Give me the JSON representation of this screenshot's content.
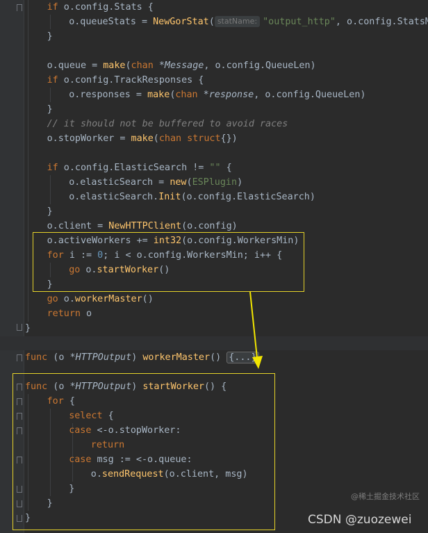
{
  "editor": {
    "lines": [
      {
        "id": "l1",
        "segments": [
          {
            "t": "if",
            "c": "kw"
          },
          {
            "t": " o.config.Stats {",
            "c": "pl"
          }
        ]
      },
      {
        "id": "l2",
        "segments": [
          {
            "t": "o.queueStats = ",
            "c": "pl"
          },
          {
            "t": "NewGorStat",
            "c": "fn"
          },
          {
            "t": "(",
            "c": "pl"
          },
          {
            "t": "statName:",
            "c": "hint"
          },
          {
            "t": "\"output_http\"",
            "c": "str"
          },
          {
            "t": ", o.config.StatsM",
            "c": "pl"
          }
        ]
      },
      {
        "id": "l3",
        "segments": [
          {
            "t": "}",
            "c": "pl"
          }
        ]
      },
      {
        "id": "l5",
        "segments": [
          {
            "t": "o.queue = ",
            "c": "pl"
          },
          {
            "t": "make",
            "c": "fn"
          },
          {
            "t": "(",
            "c": "pl"
          },
          {
            "t": "chan",
            "c": "kw"
          },
          {
            "t": " *",
            "c": "pl"
          },
          {
            "t": "Message",
            "c": "typ"
          },
          {
            "t": ", o.config.QueueLen)",
            "c": "pl"
          }
        ]
      },
      {
        "id": "l6",
        "segments": [
          {
            "t": "if",
            "c": "kw"
          },
          {
            "t": " o.config.TrackResponses {",
            "c": "pl"
          }
        ]
      },
      {
        "id": "l7",
        "segments": [
          {
            "t": "o.responses = ",
            "c": "pl"
          },
          {
            "t": "make",
            "c": "fn"
          },
          {
            "t": "(",
            "c": "pl"
          },
          {
            "t": "chan",
            "c": "kw"
          },
          {
            "t": " *",
            "c": "pl"
          },
          {
            "t": "response",
            "c": "typ"
          },
          {
            "t": ", o.config.QueueLen)",
            "c": "pl"
          }
        ]
      },
      {
        "id": "l8",
        "segments": [
          {
            "t": "}",
            "c": "pl"
          }
        ]
      },
      {
        "id": "l9",
        "segments": [
          {
            "t": "// it should not be buffered to avoid races",
            "c": "cm"
          }
        ]
      },
      {
        "id": "l10",
        "segments": [
          {
            "t": "o.stopWorker = ",
            "c": "pl"
          },
          {
            "t": "make",
            "c": "fn"
          },
          {
            "t": "(",
            "c": "pl"
          },
          {
            "t": "chan",
            "c": "kw"
          },
          {
            "t": " ",
            "c": "pl"
          },
          {
            "t": "struct",
            "c": "kw"
          },
          {
            "t": "{})",
            "c": "pl"
          }
        ]
      },
      {
        "id": "l12",
        "segments": [
          {
            "t": "if",
            "c": "kw"
          },
          {
            "t": " o.config.ElasticSearch != ",
            "c": "pl"
          },
          {
            "t": "\"\"",
            "c": "str"
          },
          {
            "t": " {",
            "c": "pl"
          }
        ]
      },
      {
        "id": "l13",
        "segments": [
          {
            "t": "o.elasticSearch = ",
            "c": "pl"
          },
          {
            "t": "new",
            "c": "fn"
          },
          {
            "t": "(",
            "c": "pl"
          },
          {
            "t": "ESPlugin",
            "c": "str"
          },
          {
            "t": ")",
            "c": "pl"
          }
        ]
      },
      {
        "id": "l14",
        "segments": [
          {
            "t": "o.elasticSearch.",
            "c": "pl"
          },
          {
            "t": "Init",
            "c": "fn"
          },
          {
            "t": "(o.config.ElasticSearch)",
            "c": "pl"
          }
        ]
      },
      {
        "id": "l15",
        "segments": [
          {
            "t": "}",
            "c": "pl"
          }
        ]
      },
      {
        "id": "l16",
        "segments": [
          {
            "t": "o.client = ",
            "c": "pl"
          },
          {
            "t": "NewHTTPClient",
            "c": "fn"
          },
          {
            "t": "(o.config)",
            "c": "pl"
          }
        ]
      },
      {
        "id": "l17",
        "segments": [
          {
            "t": "o.activeWorkers += ",
            "c": "pl"
          },
          {
            "t": "int32",
            "c": "fn"
          },
          {
            "t": "(o.config.WorkersMin)",
            "c": "pl"
          }
        ]
      },
      {
        "id": "l18",
        "segments": [
          {
            "t": "for",
            "c": "kw"
          },
          {
            "t": " i := ",
            "c": "pl"
          },
          {
            "t": "0",
            "c": "num"
          },
          {
            "t": "; i < o.config.WorkersMin; i++ {",
            "c": "pl"
          }
        ]
      },
      {
        "id": "l19",
        "segments": [
          {
            "t": "go",
            "c": "kw"
          },
          {
            "t": " o.",
            "c": "pl"
          },
          {
            "t": "startWorker",
            "c": "fn"
          },
          {
            "t": "()",
            "c": "pl"
          }
        ]
      },
      {
        "id": "l20",
        "segments": [
          {
            "t": "}",
            "c": "pl"
          }
        ]
      },
      {
        "id": "l21",
        "segments": [
          {
            "t": "go",
            "c": "kw"
          },
          {
            "t": " o.",
            "c": "pl"
          },
          {
            "t": "workerMaster",
            "c": "fn"
          },
          {
            "t": "()",
            "c": "pl"
          }
        ]
      },
      {
        "id": "l22",
        "segments": [
          {
            "t": "return",
            "c": "kw"
          },
          {
            "t": " o",
            "c": "pl"
          }
        ]
      },
      {
        "id": "l23",
        "segments": [
          {
            "t": "}",
            "c": "pl"
          }
        ]
      },
      {
        "id": "l25",
        "segments": [
          {
            "t": "func",
            "c": "kw"
          },
          {
            "t": " (o *",
            "c": "pl"
          },
          {
            "t": "HTTPOutput",
            "c": "typ"
          },
          {
            "t": ") ",
            "c": "pl"
          },
          {
            "t": "workerMaster",
            "c": "fn"
          },
          {
            "t": "() ",
            "c": "pl"
          },
          {
            "t": "{...}",
            "c": "folded"
          }
        ]
      },
      {
        "id": "l27",
        "segments": [
          {
            "t": "func",
            "c": "kw"
          },
          {
            "t": " (o *",
            "c": "pl"
          },
          {
            "t": "HTTPOutput",
            "c": "typ"
          },
          {
            "t": ") ",
            "c": "pl"
          },
          {
            "t": "startWorker",
            "c": "fn"
          },
          {
            "t": "() {",
            "c": "pl"
          }
        ]
      },
      {
        "id": "l28",
        "segments": [
          {
            "t": "for",
            "c": "kw"
          },
          {
            "t": " {",
            "c": "pl"
          }
        ]
      },
      {
        "id": "l29",
        "segments": [
          {
            "t": "select",
            "c": "kw"
          },
          {
            "t": " {",
            "c": "pl"
          }
        ]
      },
      {
        "id": "l30",
        "segments": [
          {
            "t": "case",
            "c": "kw"
          },
          {
            "t": " <-o.stopWorker:",
            "c": "pl"
          }
        ]
      },
      {
        "id": "l31",
        "segments": [
          {
            "t": "return",
            "c": "kw"
          }
        ]
      },
      {
        "id": "l32",
        "segments": [
          {
            "t": "case",
            "c": "kw"
          },
          {
            "t": " msg := <-o.queue:",
            "c": "pl"
          }
        ]
      },
      {
        "id": "l33",
        "segments": [
          {
            "t": "o.",
            "c": "pl"
          },
          {
            "t": "sendRequest",
            "c": "fn"
          },
          {
            "t": "(o.client, msg)",
            "c": "pl"
          }
        ]
      },
      {
        "id": "l34",
        "segments": [
          {
            "t": "}",
            "c": "pl"
          }
        ]
      },
      {
        "id": "l35",
        "segments": [
          {
            "t": "}",
            "c": "pl"
          }
        ]
      },
      {
        "id": "l36",
        "segments": [
          {
            "t": "}",
            "c": "pl"
          }
        ]
      }
    ]
  },
  "watermark": {
    "main": "CSDN @zuozewei",
    "faint": "@稀土掘金技术社区"
  },
  "colors": {
    "highlight_box": "#e6d32a",
    "arrow": "#f2e600"
  }
}
